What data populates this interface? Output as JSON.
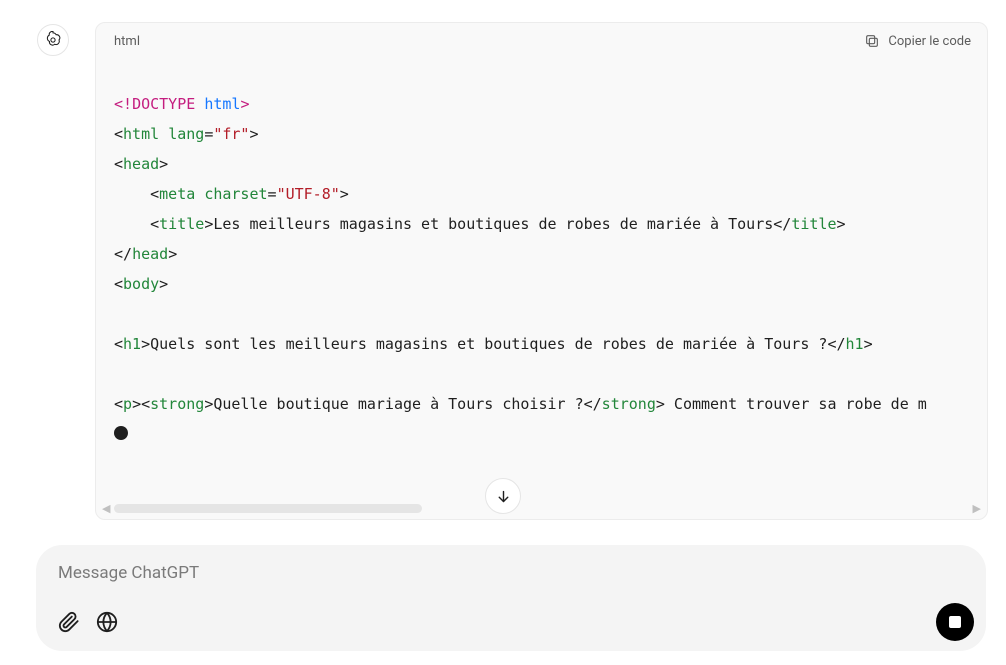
{
  "code_block": {
    "lang_label": "html",
    "copy_label": "Copier le code",
    "doctype": {
      "prefix": "<!",
      "keyword": "DOCTYPE",
      "value": "html",
      "suffix": ">"
    },
    "html_open": {
      "tag": "html",
      "attr": "lang",
      "val": "\"fr\""
    },
    "head_open": {
      "tag": "head"
    },
    "meta": {
      "tag": "meta",
      "attr": "charset",
      "val": "\"UTF-8\""
    },
    "title": {
      "tag": "title",
      "text": "Les meilleurs magasins et boutiques de robes de mariée à Tours"
    },
    "head_close": {
      "tag": "head"
    },
    "body_open": {
      "tag": "body"
    },
    "h1": {
      "tag": "h1",
      "text": "Quels sont les meilleurs magasins et boutiques de robes de mariée à Tours ?"
    },
    "p": {
      "tag": "p",
      "strong_tag": "strong",
      "strong_text": "Quelle boutique mariage à Tours choisir ?",
      "after_text": " Comment trouver sa robe de m"
    }
  },
  "composer": {
    "placeholder": "Message ChatGPT"
  }
}
